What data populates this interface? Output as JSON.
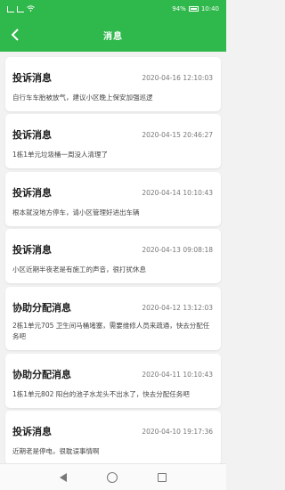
{
  "status": {
    "left_icons": [
      "sim-icon",
      "signal-icon",
      "wifi-icon"
    ],
    "battery": "94%",
    "time": "10:40"
  },
  "header": {
    "title": "消息",
    "back_icon": "chevron-left-icon"
  },
  "messages": [
    {
      "title": "投诉消息",
      "time": "2020-04-16 12:10:03",
      "body": "自行车车胎被放气，建议小区晚上保安加强巡逻"
    },
    {
      "title": "投诉消息",
      "time": "2020-04-15 20:46:27",
      "body": "1栋1单元垃圾桶一周没人清理了"
    },
    {
      "title": "投诉消息",
      "time": "2020-04-14 10:10:43",
      "body": "根本就没地方停车，请小区管理好进出车辆"
    },
    {
      "title": "投诉消息",
      "time": "2020-04-13 09:08:18",
      "body": "小区近期半夜老是有施工的声音，很打扰休息"
    },
    {
      "title": "协助分配消息",
      "time": "2020-04-12 13:12:03",
      "body": "2栋1单元705  卫生间马桶堵塞，需要维修人员来疏通，快去分配任务吧"
    },
    {
      "title": "协助分配消息",
      "time": "2020-04-11 10:10:43",
      "body": "1栋1单元802  阳台的池子水龙头不出水了，快去分配任务吧"
    },
    {
      "title": "投诉消息",
      "time": "2020-04-10 19:17:36",
      "body": "近期老是停电，很耽误事情啊"
    }
  ],
  "nav": {
    "back_icon": "triangle-back-icon",
    "home_icon": "circle-home-icon",
    "recent_icon": "square-recent-icon"
  },
  "colors": {
    "primary": "#2fb84b",
    "background": "#f2f2f2"
  }
}
